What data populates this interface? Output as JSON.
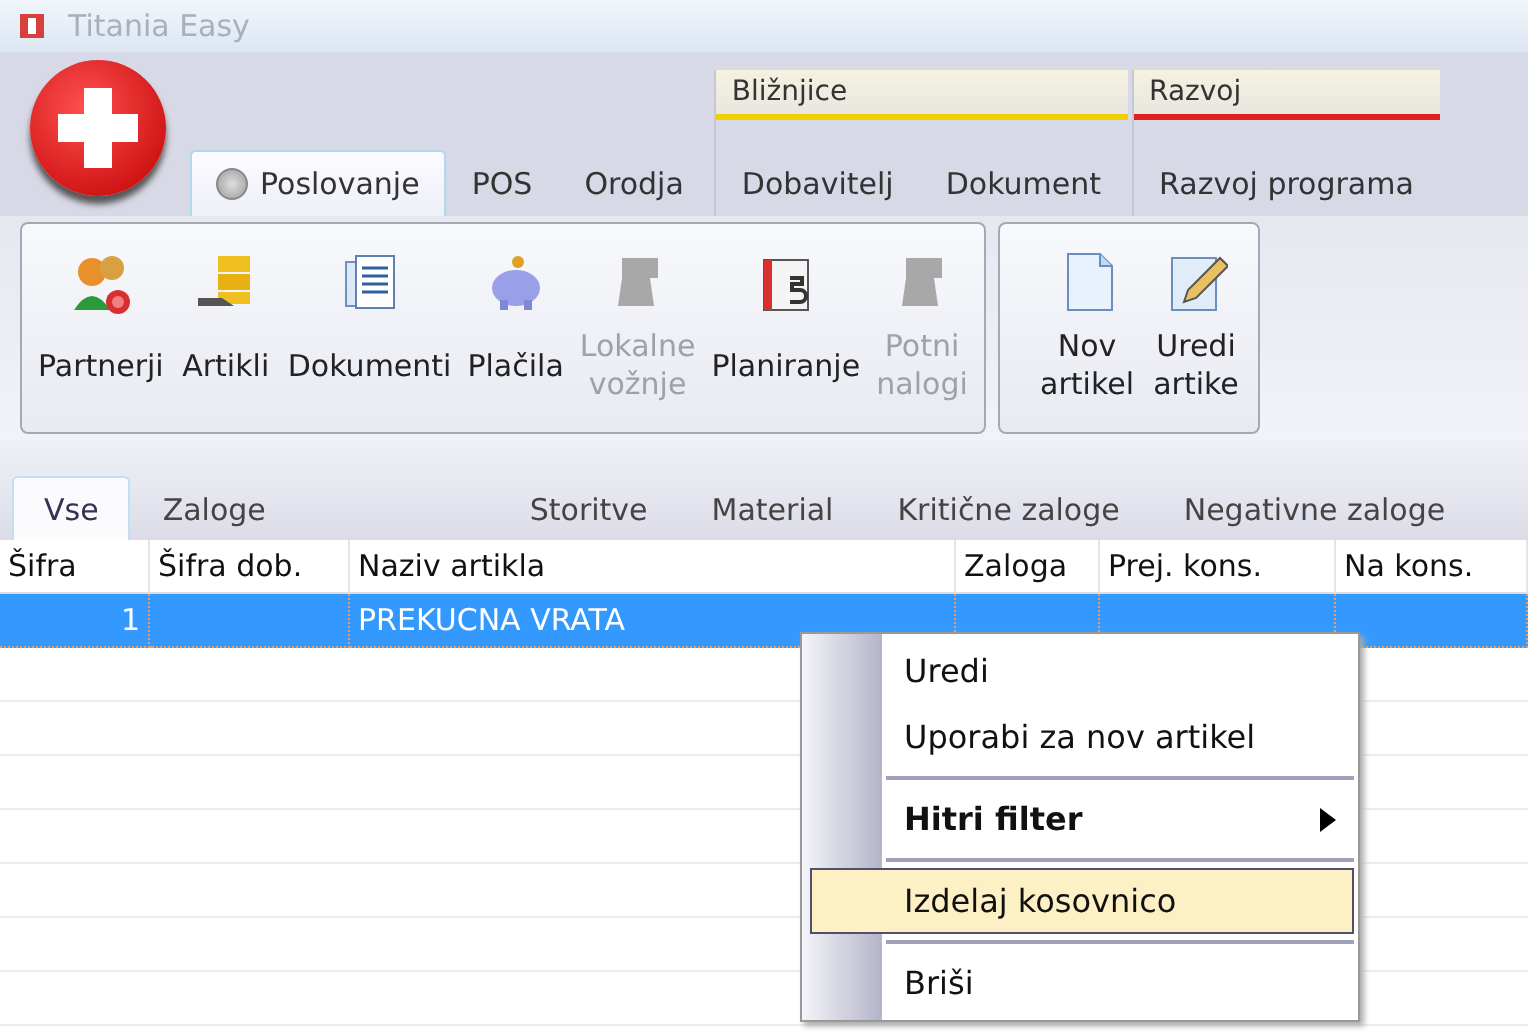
{
  "window": {
    "title": "Titania Easy"
  },
  "ribbon": {
    "tabs": [
      {
        "label": "Poslovanje",
        "selected": true
      },
      {
        "label": "POS",
        "selected": false
      },
      {
        "label": "Orodja",
        "selected": false
      }
    ],
    "contextual_groups": [
      {
        "label": "Bližnjice",
        "color": "#f0d000",
        "tabs": [
          {
            "label": "Dobavitelj",
            "selected": false
          },
          {
            "label": "Dokument",
            "selected": false
          }
        ]
      },
      {
        "label": "Razvoj",
        "color": "#e02020",
        "tabs": [
          {
            "label": "Razvoj programa",
            "selected": false
          }
        ]
      }
    ],
    "groups": [
      {
        "buttons": [
          {
            "kind": "partners",
            "lines": [
              "Partnerji"
            ],
            "disabled": false
          },
          {
            "kind": "articles",
            "lines": [
              "Artikli"
            ],
            "disabled": false
          },
          {
            "kind": "documents",
            "lines": [
              "Dokumenti"
            ],
            "disabled": false
          },
          {
            "kind": "piggy",
            "lines": [
              "Plačila"
            ],
            "disabled": false
          },
          {
            "kind": "placeholder",
            "lines": [
              "Lokalne",
              "vožnje"
            ],
            "disabled": true
          },
          {
            "kind": "calendar",
            "lines": [
              "Planiranje"
            ],
            "disabled": false
          },
          {
            "kind": "placeholder",
            "lines": [
              "Potni",
              "nalogi"
            ],
            "disabled": true
          }
        ]
      },
      {
        "buttons": [
          {
            "kind": "new-page",
            "lines": [
              "Nov",
              "artikel"
            ],
            "disabled": false
          },
          {
            "kind": "edit-page",
            "lines": [
              "Uredi",
              "artike"
            ],
            "disabled": false
          }
        ]
      }
    ]
  },
  "filters": [
    {
      "label": "Vse",
      "selected": true
    },
    {
      "label": "Zaloge",
      "selected": false
    },
    {
      "label": "Storitve",
      "selected": false
    },
    {
      "label": "Material",
      "selected": false
    },
    {
      "label": "Kritične zaloge",
      "selected": false
    },
    {
      "label": "Negativne zaloge",
      "selected": false
    }
  ],
  "table": {
    "columns": [
      "Šifra",
      "Šifra dob.",
      "Naziv artikla",
      "Zaloga",
      "Prej. kons.",
      "Na kons."
    ],
    "rows": [
      {
        "selected": true,
        "cells": [
          "1",
          "",
          "PREKUCNA VRATA",
          "",
          "",
          ""
        ]
      }
    ]
  },
  "context_menu": {
    "items": [
      {
        "kind": "item",
        "label": "Uredi",
        "bold": false,
        "submenu": false,
        "selected": false
      },
      {
        "kind": "item",
        "label": "Uporabi za nov artikel",
        "bold": false,
        "submenu": false,
        "selected": false
      },
      {
        "kind": "separator"
      },
      {
        "kind": "item",
        "label": "Hitri filter",
        "bold": true,
        "submenu": true,
        "selected": false
      },
      {
        "kind": "separator"
      },
      {
        "kind": "item",
        "label": "Izdelaj kosovnico",
        "bold": false,
        "submenu": false,
        "selected": true
      },
      {
        "kind": "separator"
      },
      {
        "kind": "item",
        "label": "Briši",
        "bold": false,
        "submenu": false,
        "selected": false
      }
    ]
  }
}
